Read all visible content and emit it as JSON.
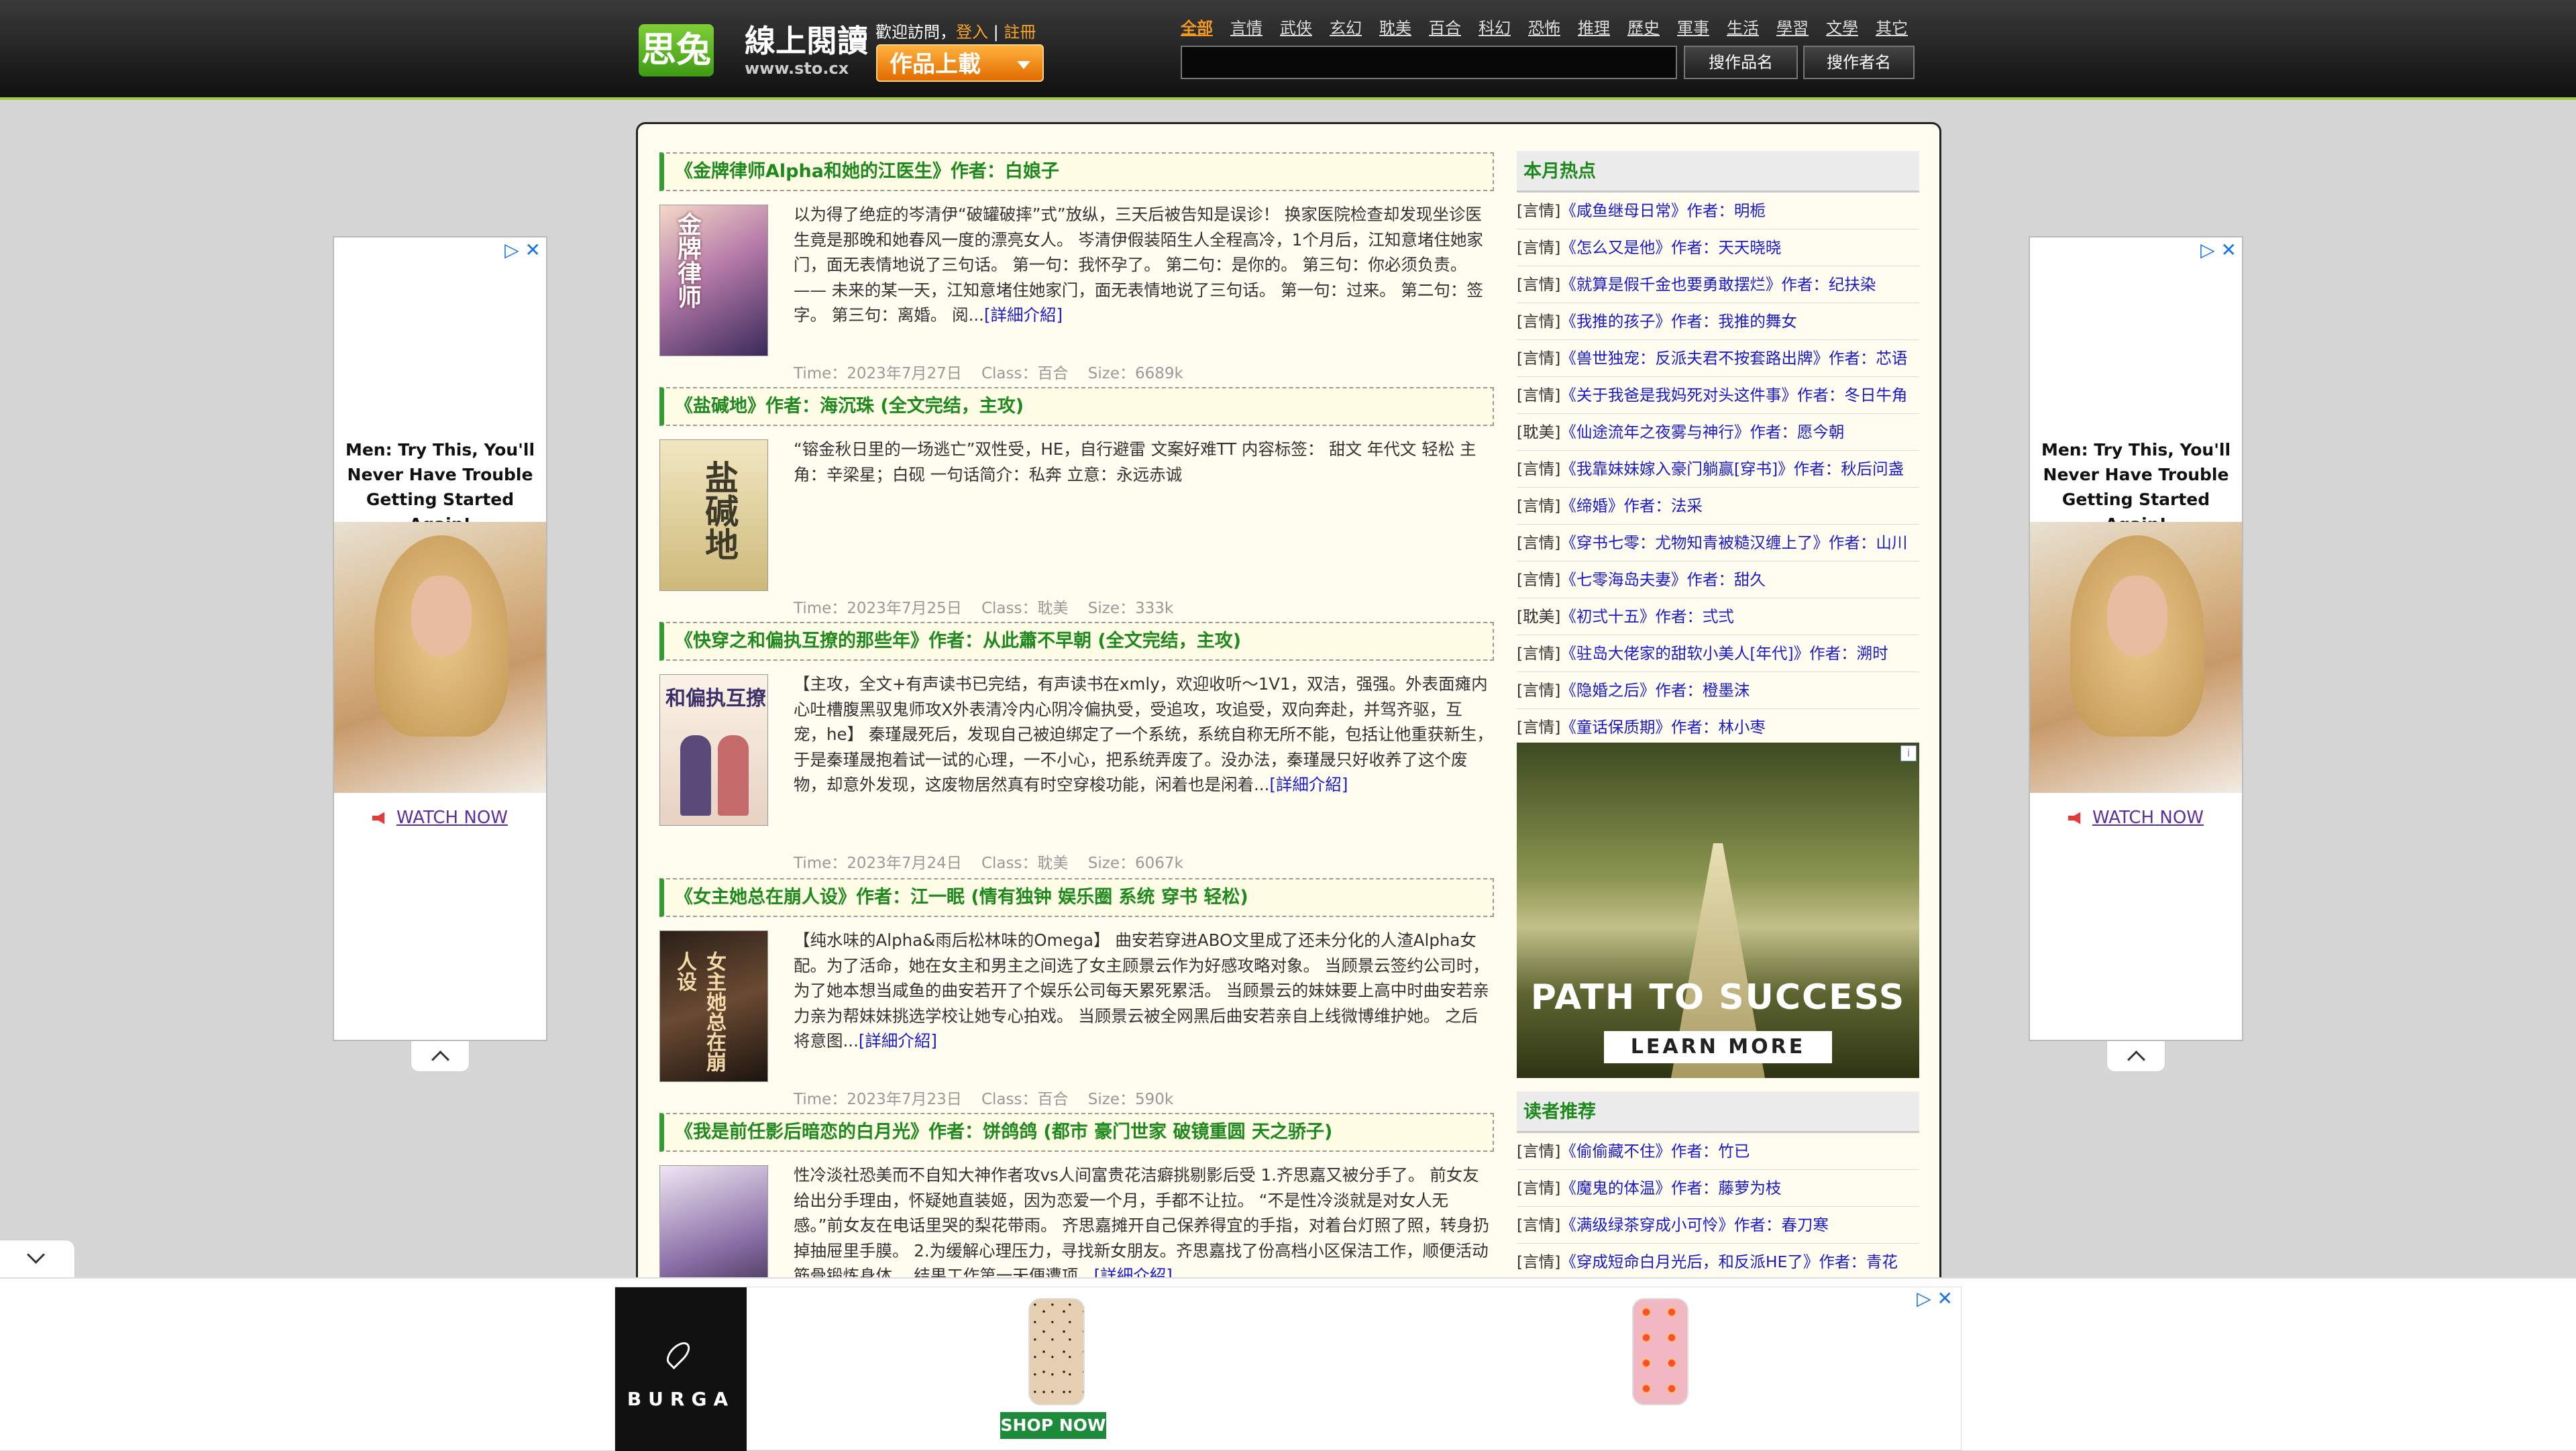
{
  "header": {
    "logo_char": "思兔",
    "logo_text": "線上閱讀",
    "logo_url": "www.sto.cx",
    "welcome": "歡迎訪問，",
    "login": "登入",
    "separator": "|",
    "register": "註冊",
    "upload": "作品上載",
    "categories": [
      "全部",
      "言情",
      "武侠",
      "玄幻",
      "耽美",
      "百合",
      "科幻",
      "恐怖",
      "推理",
      "歷史",
      "軍事",
      "生活",
      "學習",
      "文學",
      "其它"
    ],
    "search_value": "",
    "search_by_title": "搜作品名",
    "search_by_author": "搜作者名"
  },
  "books": [
    {
      "title": "《金牌律师Alpha和她的江医生》作者：白娘子",
      "desc": "以为得了绝症的岑清伊“破罐破摔”式”放纵，三天后被告知是误诊！ 换家医院检查却发现坐诊医生竟是那晚和她春风一度的漂亮女人。 岑清伊假装陌生人全程高冷，1个月后，江知意堵住她家门，面无表情地说了三句话。 第一句：我怀孕了。 第二句：是你的。 第三句：你必须负责。 —— 未来的某一天，江知意堵住她家门，面无表情地说了三句话。 第一句：过来。 第二句：签字。 第三句：离婚。 阅...",
      "more": "[詳細介紹]",
      "time": "Time：2023年7月27日",
      "cls": "Class：百合",
      "size": "Size：6689k",
      "cover": "金牌律师"
    },
    {
      "title": "《盐碱地》作者：海沉珠 (全文完结，主攻)",
      "desc": "“镕金秋日里的一场逃亡”双性受，HE，自行避雷 文案好难TT 内容标签： 甜文 年代文 轻松 主角：辛梁星；白砚 一句话简介：私奔 立意：永远赤诚",
      "more": "",
      "time": "Time：2023年7月25日",
      "cls": "Class：耽美",
      "size": "Size：333k",
      "cover": "盐碱地"
    },
    {
      "title": "《快穿之和偏执互撩的那些年》作者：从此蕭不早朝 (全文完结，主攻)",
      "desc": "【主攻，全文+有声读书已完结，有声读书在xmly，欢迎收听～1V1，双洁，强强。外表面瘫内心吐槽腹黑驭鬼师攻X外表清冷内心阴冷偏执受，受追攻，攻追受，双向奔赴，并驾齐驱，互宠，he】 秦瑾晟死后，发现自己被迫绑定了一个系统，系统自称无所不能，包括让他重获新生，于是秦瑾晟抱着试一试的心理，一不小心，把系统弄废了。没办法，秦瑾晟只好收养了这个废物，却意外发现，这废物居然真有时空穿梭功能，闲着也是闲着...",
      "more": "[詳細介紹]",
      "time": "Time：2023年7月24日",
      "cls": "Class：耽美",
      "size": "Size：6067k",
      "cover": "和偏执互撩"
    },
    {
      "title": "《女主她总在崩人设》作者：江一眠 (情有独钟 娱乐圈 系统 穿书 轻松)",
      "desc": "【纯水味的Alpha&雨后松林味的Omega】 曲安若穿进ABO文里成了还未分化的人渣Alpha女配。为了活命，她在女主和男主之间选了女主顾景云作为好感攻略对象。 当顾景云签约公司时，为了她本想当咸鱼的曲安若开了个娱乐公司每天累死累活。 当顾景云的妹妹要上高中时曲安若亲力亲为帮妹妹挑选学校让她专心拍戏。 当顾景云被全网黑后曲安若亲自上线微博维护她。 之后将意图...",
      "more": "[詳細介紹]",
      "time": "Time：2023年7月23日",
      "cls": "Class：百合",
      "size": "Size：590k",
      "cover": "女主她总在崩人设"
    },
    {
      "title": "《我是前任影后暗恋的白月光》作者：饼鸽鸽 (都市 豪门世家 破镜重圆 天之骄子)",
      "desc": "性冷淡社恐美而不自知大神作者攻vs人间富贵花洁癖挑剔影后受 1.齐思嘉又被分手了。 前女友给出分手理由，怀疑她直装姬，因为恋爱一个月，手都不让拉。 “不是性冷淡就是对女人无感。”前女友在电话里哭的梨花带雨。 齐思嘉摊开自己保养得宜的手指，对着台灯照了照，转身扔掉抽屉里手膜。 2.为缓解心理压力，寻找新女朋友。齐思嘉找了份高档小区保洁工作，顺便活动筋骨锻炼身体。 结果工作第一天便遭项...",
      "more": "[詳細介紹]",
      "time": "",
      "cls": "",
      "size": "",
      "cover": ""
    }
  ],
  "sidebar": {
    "hot_title": "本月热点",
    "hot": [
      {
        "tag": "[言情]",
        "name": "《咸鱼继母日常》作者：明栀"
      },
      {
        "tag": "[言情]",
        "name": "《怎么又是他》作者：天天晓晓"
      },
      {
        "tag": "[言情]",
        "name": "《就算是假千金也要勇敢摆烂》作者：纪扶染"
      },
      {
        "tag": "[言情]",
        "name": "《我推的孩子》作者：我推的舞女"
      },
      {
        "tag": "[言情]",
        "name": "《兽世独宠：反派夫君不按套路出牌》作者：芯语"
      },
      {
        "tag": "[言情]",
        "name": "《关于我爸是我妈死对头这件事》作者：冬日牛角"
      },
      {
        "tag": "[耽美]",
        "name": "《仙途流年之夜雾与神行》作者：愿今朝"
      },
      {
        "tag": "[言情]",
        "name": "《我靠妹妹嫁入豪门躺赢[穿书]》作者：秋后问盏"
      },
      {
        "tag": "[言情]",
        "name": "《缔婚》作者：法采"
      },
      {
        "tag": "[言情]",
        "name": "《穿书七零：尤物知青被糙汉缠上了》作者：山川"
      },
      {
        "tag": "[言情]",
        "name": "《七零海岛夫妻》作者：甜久"
      },
      {
        "tag": "[耽美]",
        "name": "《初弍十五》作者：弍弍"
      },
      {
        "tag": "[言情]",
        "name": "《驻岛大佬家的甜软小美人[年代]》作者：溯时"
      },
      {
        "tag": "[言情]",
        "name": "《隐婚之后》作者：橙墨沫"
      },
      {
        "tag": "[言情]",
        "name": "《童话保质期》作者：林小枣"
      }
    ],
    "ad_slogan": "PATH TO SUCCESS",
    "ad_cta": "LEARN MORE",
    "rec_title": "读者推荐",
    "rec": [
      {
        "tag": "[言情]",
        "name": "《偷偷藏不住》作者：竹已"
      },
      {
        "tag": "[言情]",
        "name": "《魔鬼的体温》作者：藤萝为枝"
      },
      {
        "tag": "[言情]",
        "name": "《满级绿茶穿成小可怜》作者：春刀寒"
      },
      {
        "tag": "[言情]",
        "name": "《穿成短命白月光后，和反派HE了》作者：青花"
      }
    ]
  },
  "skyscraper": {
    "headline": "Men: Try This, You'll Never Have Trouble Getting Started Again!",
    "cta": "WATCH NOW"
  },
  "bottom_ad": {
    "brand": "BURGA",
    "cta": "SHOP NOW"
  }
}
